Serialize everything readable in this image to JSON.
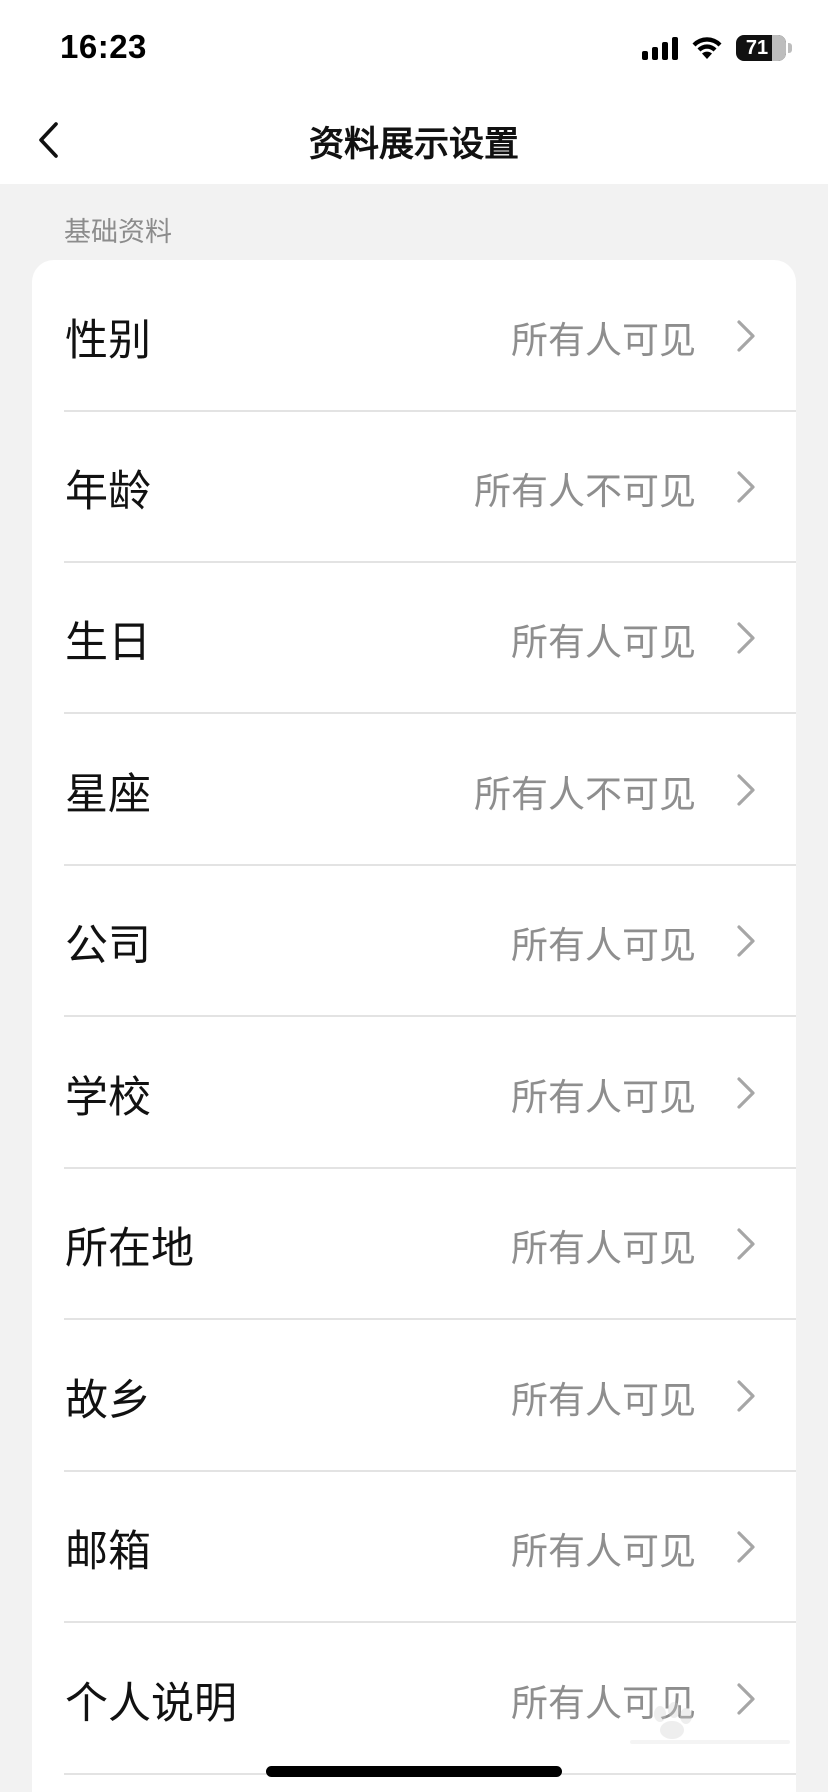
{
  "status_bar": {
    "time": "16:23",
    "battery": "71",
    "icons": [
      "signal-icon",
      "wifi-icon",
      "battery-icon"
    ]
  },
  "nav": {
    "title": "资料展示设置",
    "back_icon": "chevron-left-icon"
  },
  "section": {
    "title": "基础资料"
  },
  "items": [
    {
      "label": "性别",
      "value": "所有人可见"
    },
    {
      "label": "年龄",
      "value": "所有人不可见"
    },
    {
      "label": "生日",
      "value": "所有人可见"
    },
    {
      "label": "星座",
      "value": "所有人不可见"
    },
    {
      "label": "公司",
      "value": "所有人可见"
    },
    {
      "label": "学校",
      "value": "所有人可见"
    },
    {
      "label": "所在地",
      "value": "所有人可见"
    },
    {
      "label": "故乡",
      "value": "所有人可见"
    },
    {
      "label": "邮箱",
      "value": "所有人可见"
    },
    {
      "label": "个人说明",
      "value": "所有人可见"
    }
  ],
  "colors": {
    "background": "#f2f2f2",
    "card": "#ffffff",
    "label": "#111111",
    "value": "#8e8e8e",
    "chevron": "#a6a6a6"
  }
}
